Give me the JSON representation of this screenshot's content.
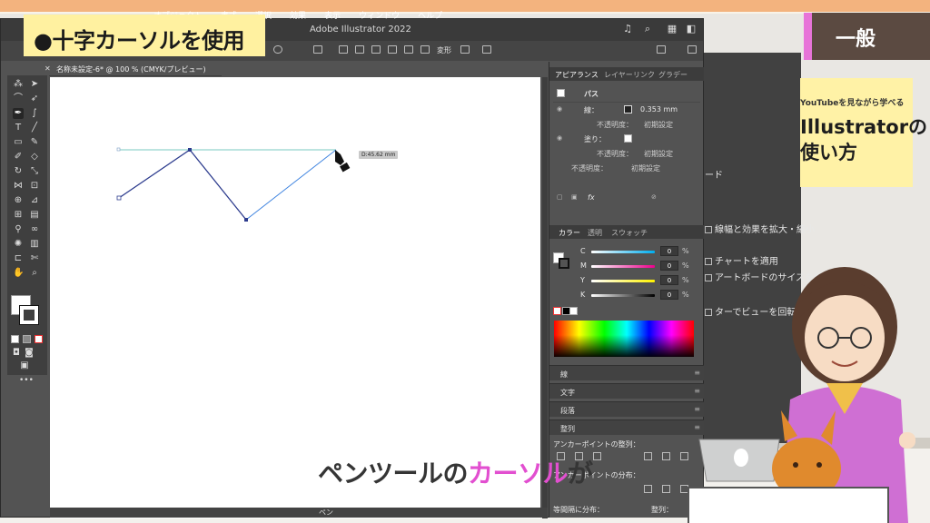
{
  "menubar": [
    "オブジェクト",
    "書式",
    "選択",
    "効果",
    "表示",
    "ウィンドウ",
    "ヘルプ"
  ],
  "app_title": "Adobe Illustrator 2022",
  "control_bar": {
    "transform_label": "変形"
  },
  "document_tab": "名称未設定-6* @ 100 % (CMYK/プレビュー)",
  "canvas": {
    "distance_tooltip": "D:45.62 mm"
  },
  "status_bar": {
    "tool_name": "ペン"
  },
  "appearance_panel": {
    "tabs": [
      "アピアランス",
      "レイヤー",
      "リンク",
      "グラデー"
    ],
    "object_type": "パス",
    "stroke_label": "線：",
    "stroke_value": "0.353 mm",
    "opacity_label": "不透明度：",
    "opacity_value": "初期設定",
    "fill_label": "塗り：",
    "fill_opacity_label": "不透明度：",
    "fill_opacity_value": "初期設定",
    "bottom_opacity_label": "不透明度：",
    "bottom_opacity_value": "初期設定",
    "fx_label": "fx"
  },
  "color_panel": {
    "tabs": [
      "カラー",
      "透明",
      "スウォッチ"
    ],
    "channels": [
      {
        "label": "C",
        "value": "0",
        "unit": "%"
      },
      {
        "label": "M",
        "value": "0",
        "unit": "%"
      },
      {
        "label": "Y",
        "value": "0",
        "unit": "%"
      },
      {
        "label": "K",
        "value": "0",
        "unit": "%"
      }
    ]
  },
  "collapsed_panels": [
    "線",
    "文字",
    "段落",
    "整列"
  ],
  "align_panel": {
    "anchor_align_label": "アンカーポイントの整列：",
    "anchor_distribute_label": "アンカーポイントの分布：",
    "spacing_label": "等間隔に分布：",
    "align_to_label": "整列："
  },
  "back_window": {
    "lines": [
      "ード",
      "線幅と効果を拡大・縮小",
      "チャートを適用",
      "アートボードのサイズを維持",
      "ターでビューを回転"
    ]
  },
  "overlay": {
    "caption": "●十字カーソルを使用",
    "category": "一般",
    "promo_sub": "YouTubeを見ながら学べる",
    "promo_title_line1": "Illustratorの",
    "promo_title_line2": "使い方",
    "subtitle_pre": "ペンツールの",
    "subtitle_highlight": "カーソル",
    "subtitle_post": "が"
  },
  "colors": {
    "panel_bg": "#535353",
    "artboard": "#ffffff",
    "path_stroke": "#2d3c8e",
    "guide_line": "#78c9c0",
    "highlight_pink": "#e24fd0",
    "banner_yellow": "#fff1a0"
  }
}
